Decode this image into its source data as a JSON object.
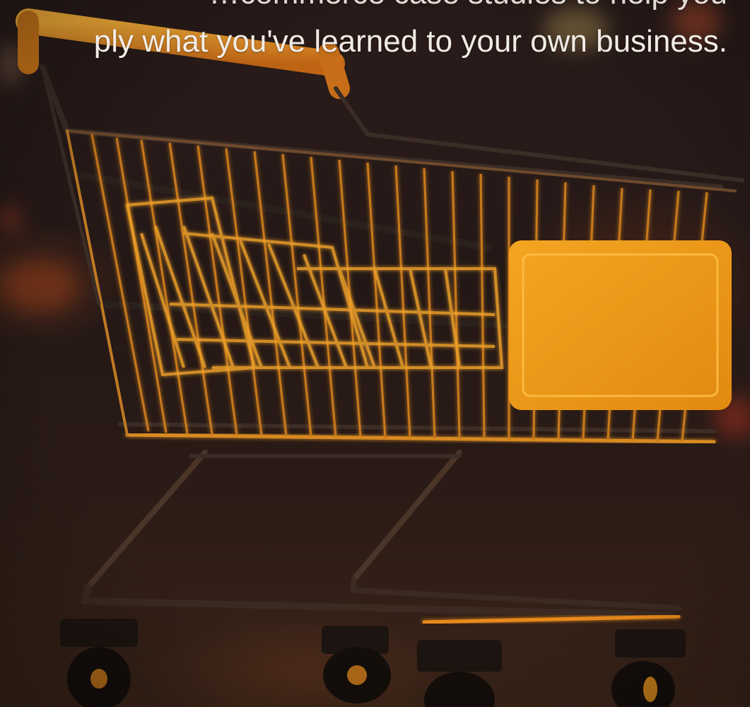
{
  "hero": {
    "line1": "…commerce case studies to help you",
    "line2": "ply what you've learned to your own business.",
    "image_alt": "shopping-cart-photo"
  },
  "colors": {
    "glow_orange": "#f7a623",
    "wire_dark": "#3a2a22",
    "text": "#f2ece6"
  }
}
